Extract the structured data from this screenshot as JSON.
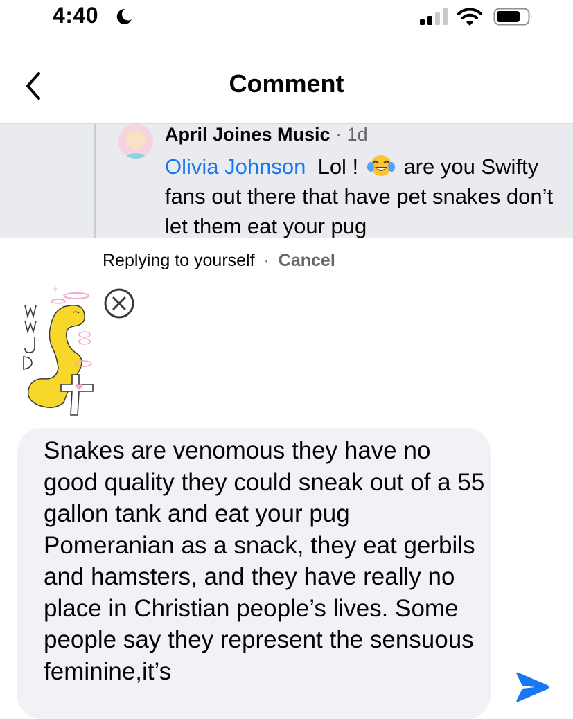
{
  "status_bar": {
    "time": "4:40",
    "icons": [
      "moon-icon",
      "cellular-signal-icon",
      "wifi-icon",
      "battery-icon"
    ]
  },
  "nav": {
    "title": "Comment",
    "back_icon": "chevron-left-icon"
  },
  "quoted_comment": {
    "author": "April Joines Music",
    "separator": "·",
    "time": "1d",
    "mention": "Olivia Johnson",
    "text_before_emoji": "Lol !",
    "emoji": "face-with-tears-of-joy",
    "text_after_emoji": "are you Swifty fans out there that have pet snakes don’t let them eat your pug"
  },
  "reply_bar": {
    "label": "Replying to yourself",
    "separator": "·",
    "cancel_label": "Cancel"
  },
  "composer": {
    "text": "Snakes are venomous they have no good quality they could sneak out of a 55 gallon tank and eat your pug Pomeranian as a snack, they eat gerbils and hamsters, and they have really no place in Christian people’s lives. Some people say they represent the sensuous feminine,it’s",
    "sticker_text": "WWJD",
    "send_icon": "send-icon",
    "remove_icon": "close-circle-icon"
  },
  "colors": {
    "accent": "#1877f2",
    "quoted_bg": "#e9ebee",
    "composer_bg": "#f0f2f5",
    "muted_text": "#65676b"
  }
}
